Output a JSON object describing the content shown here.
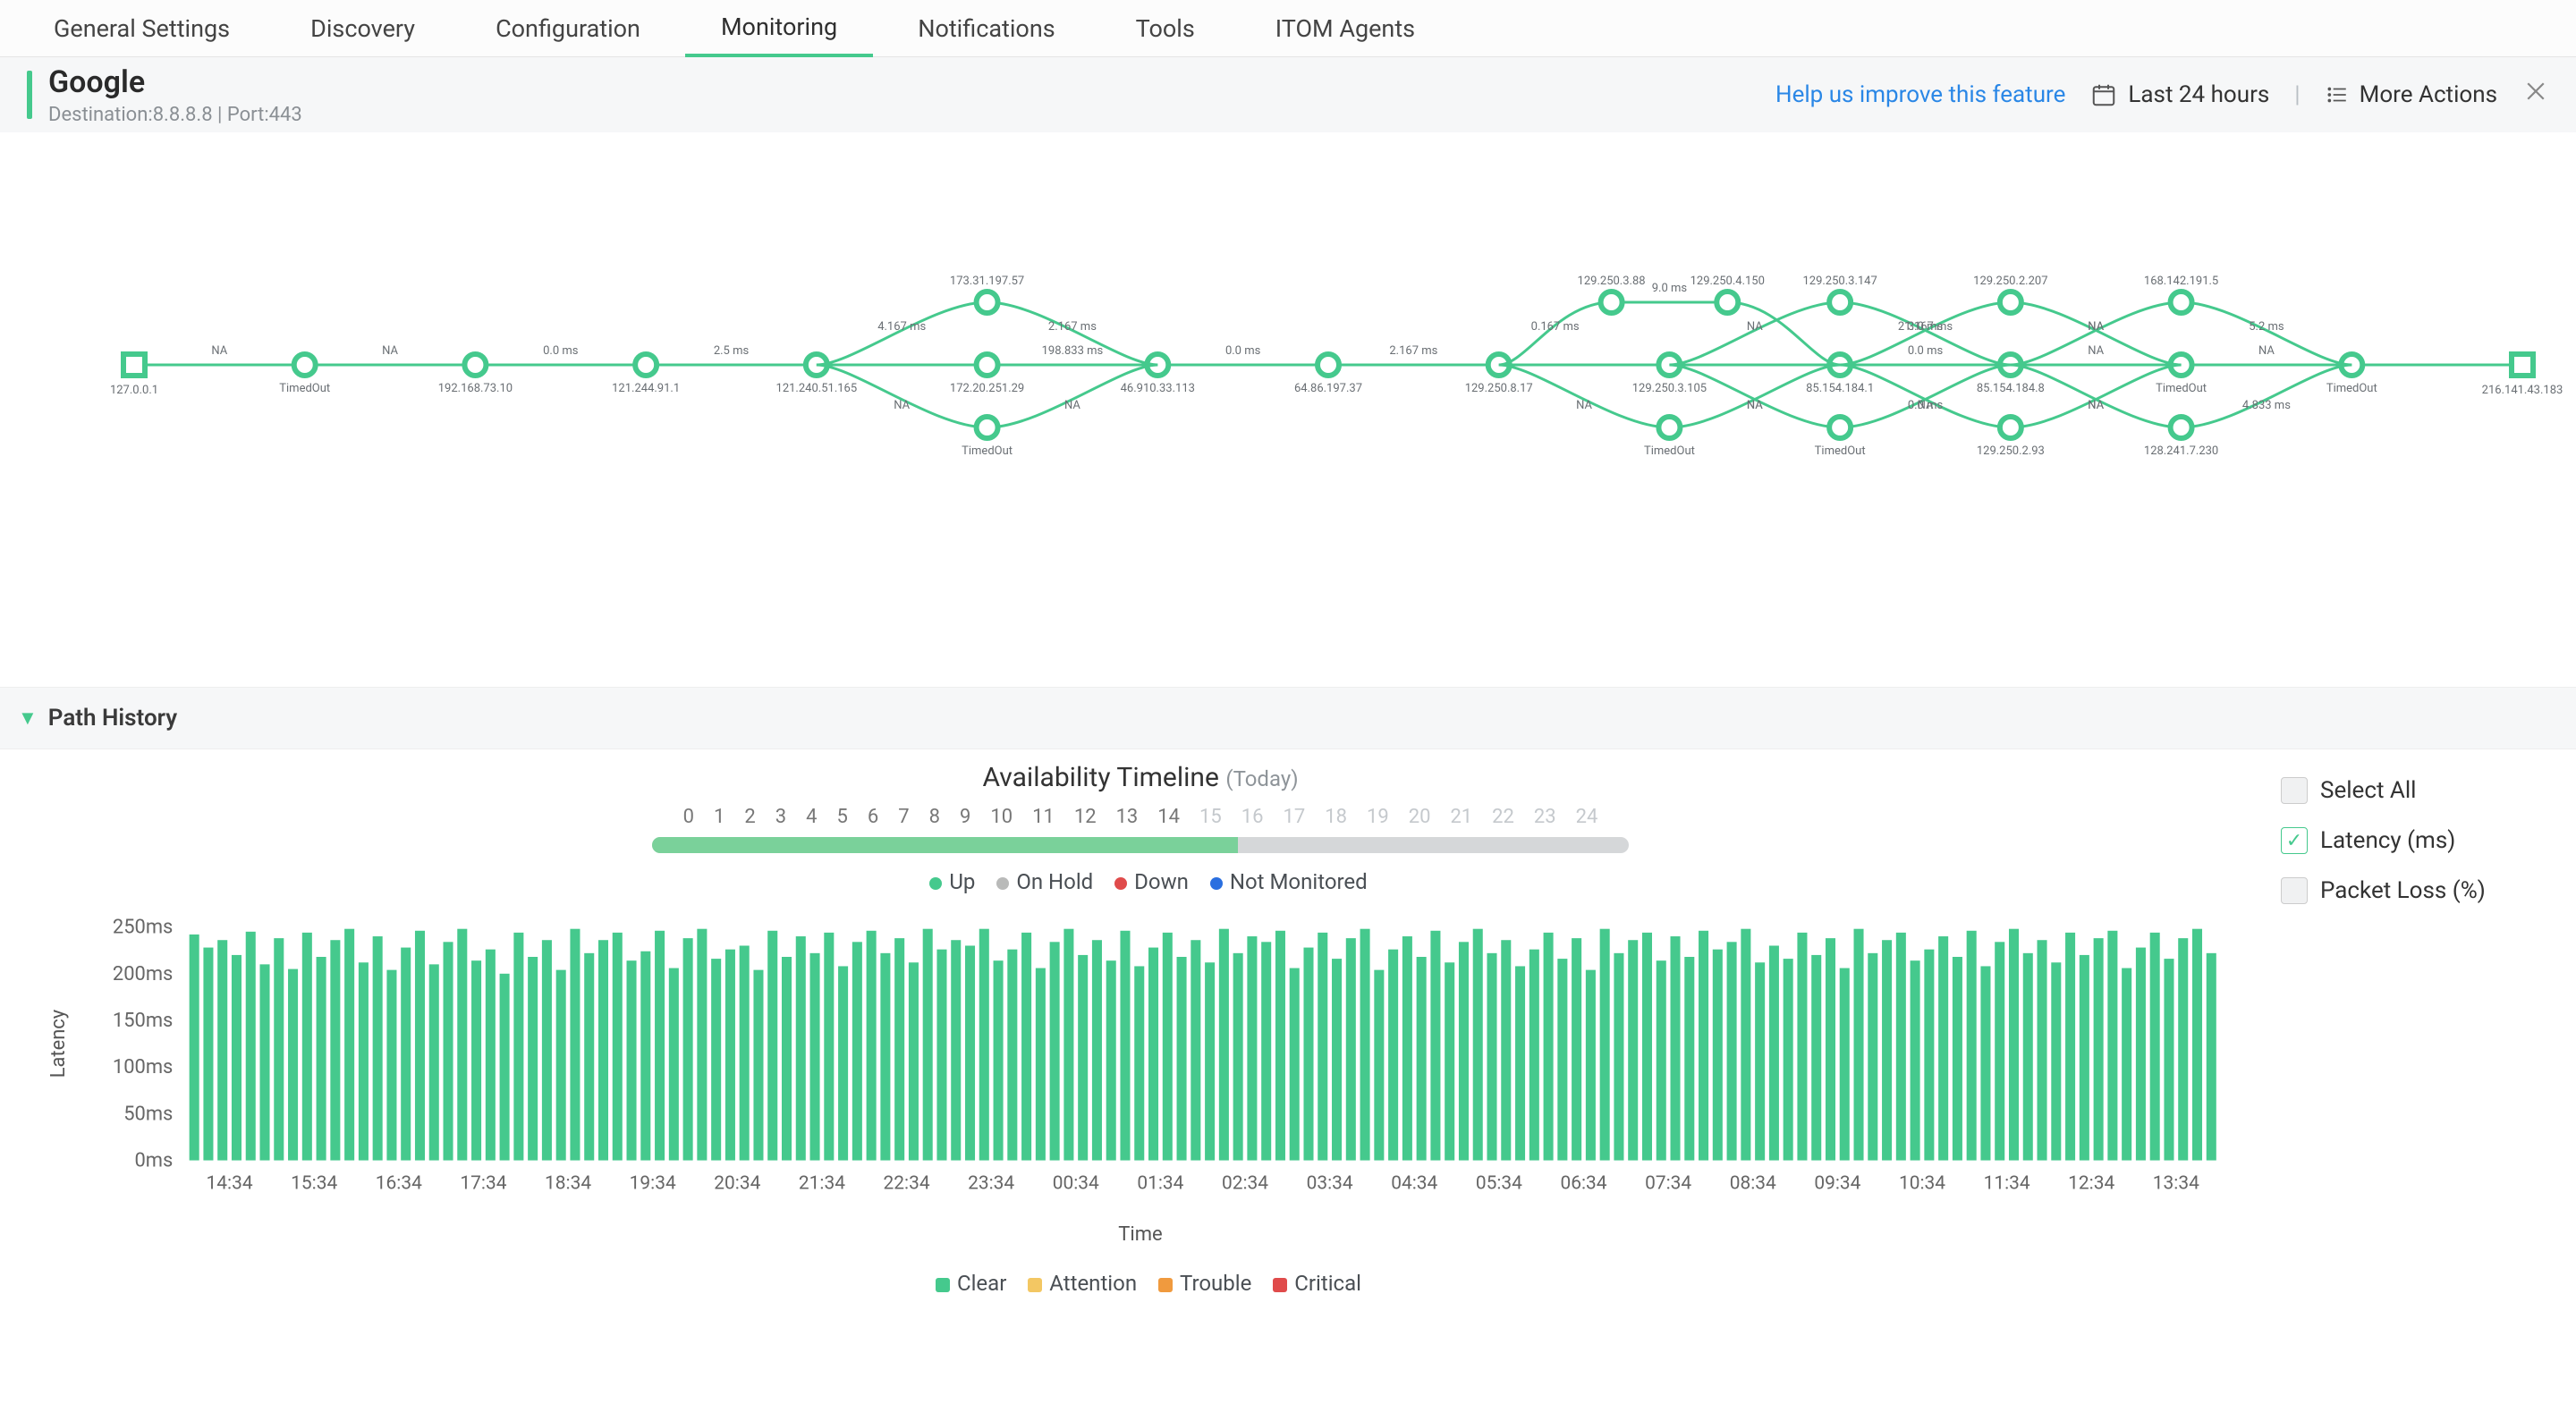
{
  "tabs": {
    "general": "General Settings",
    "discovery": "Discovery",
    "configuration": "Configuration",
    "monitoring": "Monitoring",
    "notifications": "Notifications",
    "tools": "Tools",
    "itom": "ITOM Agents"
  },
  "subheader": {
    "title": "Google",
    "subtitle": "Destination:8.8.8.8 | Port:443",
    "help": "Help us improve this feature",
    "time_range": "Last 24 hours",
    "more_actions": "More Actions"
  },
  "topology": {
    "start_label": "127.0.0.1",
    "end_label": "216.141.43.183",
    "main_chain": [
      {
        "label": "TimedOut",
        "edge": "NA"
      },
      {
        "label": "192.168.73.10",
        "edge": "NA"
      },
      {
        "label": "121.244.91.1",
        "edge": "0.0 ms"
      },
      {
        "label": "121.240.51.165",
        "edge": "2.5 ms"
      },
      {
        "label": "172.20.251.29",
        "edge": ""
      },
      {
        "label": "46.910.33.113",
        "edge": "198.833 ms"
      },
      {
        "label": "64.86.197.37",
        "edge": "0.0 ms"
      },
      {
        "label": "129.250.8.17",
        "edge": "2.167 ms"
      },
      {
        "label": "129.250.3.105",
        "edge": ""
      },
      {
        "label": "85.154.184.1",
        "edge": ""
      },
      {
        "label": "85.154.184.8",
        "edge": "0.0 ms"
      },
      {
        "label": "TimedOut",
        "edge": "NA"
      },
      {
        "label": "TimedOut",
        "edge": "NA"
      }
    ],
    "branches": [
      {
        "center_index": 4,
        "top": "173.31.197.57",
        "bottom": "TimedOut",
        "top_pre": "4.167 ms",
        "top_post": "2.167 ms",
        "bot_pre": "NA",
        "bot_post": "NA"
      },
      {
        "center_index": 8,
        "wide": true,
        "top_a": "129.250.3.88",
        "top_b": "129.250.4.150",
        "bottom": "TimedOut",
        "top_pre": "0.167 ms",
        "top_mid": "9.0 ms",
        "top_post": "",
        "bot_pre": "NA",
        "bot_post": "NA"
      },
      {
        "center_index": 9,
        "top": "129.250.3.147",
        "bottom": "TimedOut",
        "top_pre": "NA",
        "top_post": "21.167 ms",
        "bot_pre": "NA",
        "bot_post": "NA"
      },
      {
        "center_index": 10,
        "top": "129.250.2.207",
        "bottom": "129.250.2.93",
        "top_pre": "3.0 ms",
        "top_post": "NA",
        "bot_pre": "0.0 ms",
        "bot_post": "NA"
      },
      {
        "center_index": 11,
        "top": "168.142.191.5",
        "bottom": "128.241.7.230",
        "top_pre": "NA",
        "top_post": "5.2 ms",
        "bot_pre": "NA",
        "bot_post": "4.833 ms"
      }
    ]
  },
  "path_history_label": "Path History",
  "timeline": {
    "title": "Availability Timeline",
    "paren": "(Today)",
    "hours": [
      "0",
      "1",
      "2",
      "3",
      "4",
      "5",
      "6",
      "7",
      "8",
      "9",
      "10",
      "11",
      "12",
      "13",
      "14",
      "15",
      "16",
      "17",
      "18",
      "19",
      "20",
      "21",
      "22",
      "23",
      "24"
    ],
    "fade_from": 15,
    "fill_pct": 60,
    "legend": {
      "up": "Up",
      "hold": "On Hold",
      "down": "Down",
      "notmon": "Not Monitored"
    },
    "colors": {
      "up": "#45c98d",
      "hold": "#b9bab9",
      "down": "#e04b4b",
      "notmon": "#2a6fe0"
    }
  },
  "chart_data": {
    "type": "bar",
    "title": "",
    "ylabel": "Latency",
    "xlabel": "Time",
    "ylim": [
      0,
      250
    ],
    "yticks": [
      "0ms",
      "50ms",
      "100ms",
      "150ms",
      "200ms",
      "250ms"
    ],
    "xticks": [
      "14:34",
      "15:34",
      "16:34",
      "17:34",
      "18:34",
      "19:34",
      "20:34",
      "21:34",
      "22:34",
      "23:34",
      "00:34",
      "01:34",
      "02:34",
      "03:34",
      "04:34",
      "05:34",
      "06:34",
      "07:34",
      "08:34",
      "09:34",
      "10:34",
      "11:34",
      "12:34",
      "13:34"
    ],
    "values": [
      242,
      228,
      236,
      220,
      245,
      210,
      238,
      205,
      244,
      218,
      236,
      248,
      212,
      240,
      204,
      228,
      246,
      210,
      234,
      248,
      214,
      226,
      200,
      244,
      218,
      236,
      204,
      248,
      222,
      236,
      244,
      214,
      224,
      246,
      206,
      238,
      248,
      216,
      226,
      230,
      204,
      246,
      218,
      240,
      222,
      244,
      208,
      234,
      246,
      222,
      238,
      212,
      248,
      226,
      236,
      230,
      248,
      214,
      226,
      244,
      206,
      234,
      248,
      220,
      236,
      214,
      246,
      208,
      228,
      244,
      218,
      236,
      212,
      248,
      222,
      240,
      234,
      246,
      206,
      228,
      244,
      216,
      238,
      248,
      204,
      226,
      240,
      218,
      246,
      212,
      234,
      248,
      222,
      236,
      208,
      226,
      244,
      216,
      238,
      204,
      248,
      222,
      236,
      244,
      214,
      240,
      218,
      246,
      226,
      234,
      248,
      212,
      230,
      216,
      244,
      220,
      238,
      206,
      248,
      222,
      236,
      244,
      214,
      226,
      240,
      218,
      246,
      208,
      234,
      248,
      222,
      236,
      212,
      244,
      220,
      238,
      246,
      206,
      228,
      244,
      216,
      238,
      248,
      222
    ]
  },
  "severity_legend": {
    "clear": "Clear",
    "attention": "Attention",
    "trouble": "Trouble",
    "critical": "Critical",
    "colors": {
      "clear": "#45c98d",
      "attention": "#f3c763",
      "trouble": "#f09a3e",
      "critical": "#e04b4b"
    }
  },
  "side_checks": {
    "select_all": "Select All",
    "latency": "Latency (ms)",
    "packet_loss": "Packet Loss (%)"
  }
}
